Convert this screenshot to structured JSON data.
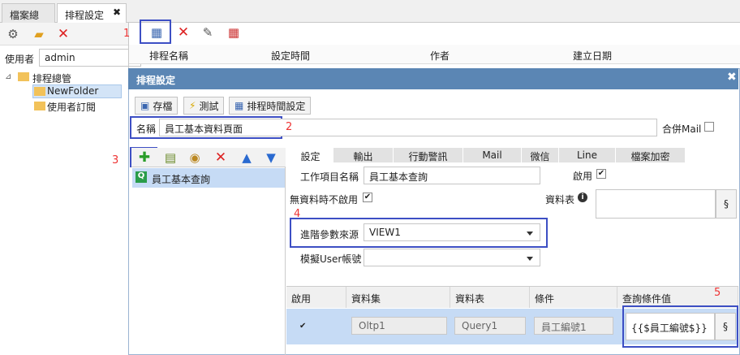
{
  "tabs": [
    {
      "label": "檔案總管"
    },
    {
      "label": "排程設定"
    }
  ],
  "left": {
    "user_label": "使用者",
    "user_value": "admin",
    "tree_root": "排程總管",
    "tree_children": [
      "NewFolder",
      "使用者訂閱"
    ]
  },
  "list_headers": [
    "排程名稱",
    "設定時間",
    "作者",
    "建立日期"
  ],
  "dialog": {
    "title": "排程設定",
    "save": "存檔",
    "test": "測試",
    "schedule": "排程時間設定",
    "name_label": "名稱",
    "name_value": "員工基本資料頁面",
    "merge_mail": "合併Mail",
    "tasks": [
      "員工基本查詢"
    ],
    "subtabs": [
      "設定",
      "輸出",
      "行動警訊",
      "Mail",
      "微信",
      "Line",
      "檔案加密"
    ],
    "form": {
      "task_name_label": "工作項目名稱",
      "task_name_value": "員工基本查詢",
      "enabled_label": "啟用",
      "no_data_label": "無資料時不啟用",
      "table_label": "資料表",
      "adv_param_label": "進階參數來源",
      "adv_param_value": "VIEW1",
      "sim_user_label": "模擬User帳號",
      "sim_user_value": ""
    },
    "grid": {
      "headers": [
        "啟用",
        "資料集",
        "資料表",
        "條件",
        "查詢條件值"
      ],
      "row": {
        "dataset": "Oltp1",
        "table": "Query1",
        "condition": "員工編號1",
        "value": "{{$員工編號$}}"
      }
    }
  },
  "markers": [
    "1",
    "2",
    "3",
    "4",
    "5"
  ],
  "colors": {
    "header": "#5b86b4",
    "highlight": "#3d4fc4",
    "marker": "#e33",
    "selected": "#c6dbf5"
  }
}
